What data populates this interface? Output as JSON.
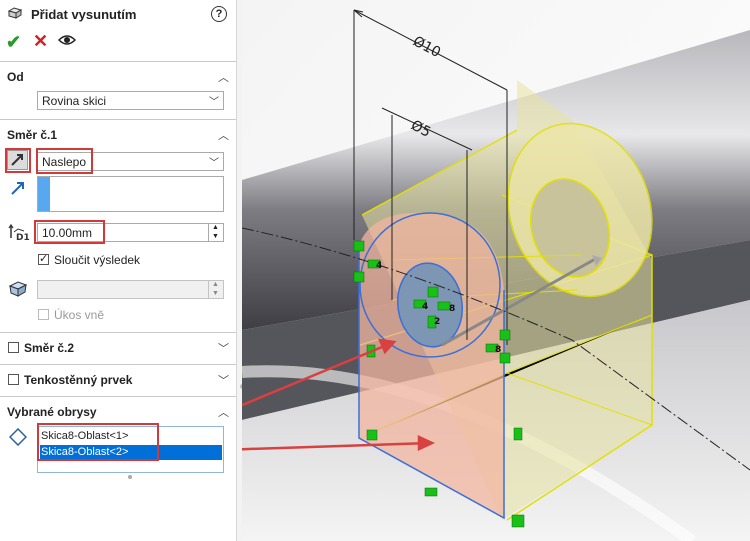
{
  "panel": {
    "title": "Přidat vysunutím",
    "help_icon": "question-circle-icon",
    "actions": {
      "ok_icon": "check-icon",
      "cancel_icon": "close-icon",
      "preview_icon": "eye-icon"
    },
    "from": {
      "label": "Od",
      "value": "Rovina skici"
    },
    "direction1": {
      "label": "Směr č.1",
      "end_condition": "Naslepo",
      "depth": "10.00mm",
      "merge_result": {
        "label": "Sloučit výsledek",
        "checked": true
      },
      "draft_outward": {
        "label": "Úkos vně",
        "checked": false
      }
    },
    "direction2": {
      "label": "Směr č.2",
      "checked": false
    },
    "thin_feature": {
      "label": "Tenkostěnný prvek",
      "checked": false
    },
    "selected_contours": {
      "label": "Vybrané obrysy",
      "items": [
        "Skica8-Oblast<1>",
        "Skica8-Oblast<2>"
      ],
      "selected_index": 1
    }
  },
  "viewport": {
    "dimensions": [
      "Ø10",
      "Ø5"
    ],
    "sketch_labels": [
      "4",
      "4",
      "8",
      "2",
      "8"
    ]
  },
  "colors": {
    "accent": "#d23a3a",
    "selection": "#0070d8",
    "sketch": "#3a6fd8",
    "body": "#e3dc8a"
  }
}
